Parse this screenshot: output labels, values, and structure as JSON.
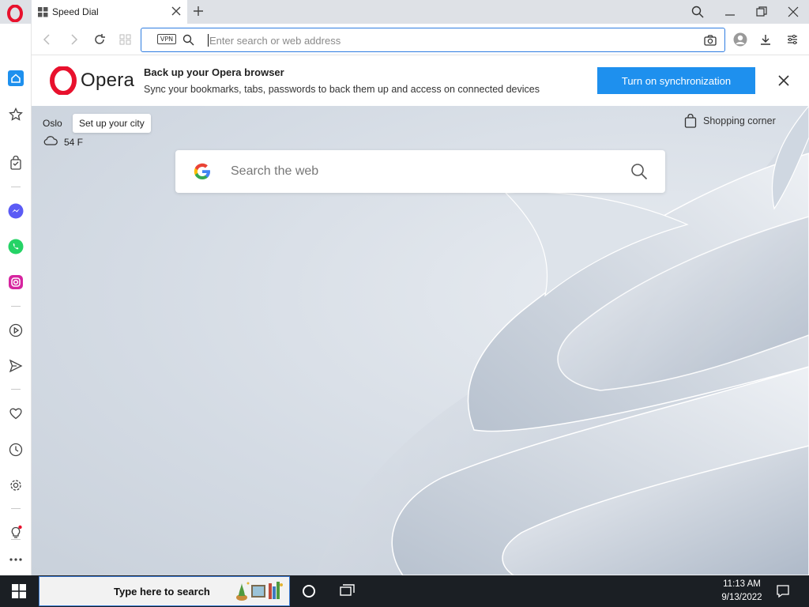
{
  "browser": {
    "tab_title": "Speed Dial",
    "url_placeholder": "Enter search or web address",
    "vpn_label": "VPN"
  },
  "sidebar": {
    "items": [
      "home",
      "bookmarks",
      "shopping",
      "messenger",
      "whatsapp",
      "instagram",
      "player",
      "send",
      "favorites",
      "history",
      "settings",
      "tips",
      "more"
    ]
  },
  "banner": {
    "logo_text": "Opera",
    "title": "Back up your Opera browser",
    "subtitle": "Sync your bookmarks, tabs, passwords to back them up and access on connected devices",
    "button": "Turn on synchronization"
  },
  "speed_dial": {
    "city": "Oslo",
    "city_tooltip": "Set up your city",
    "temperature": "54 F",
    "shopping_corner": "Shopping corner",
    "search_placeholder": "Search the web"
  },
  "taskbar": {
    "search_text": "Type here to search",
    "time": "11:13 AM",
    "date": "9/13/2022"
  },
  "colors": {
    "accent": "#1e90ee",
    "opera_red": "#e8112d",
    "taskbar": "#1b1f24"
  }
}
